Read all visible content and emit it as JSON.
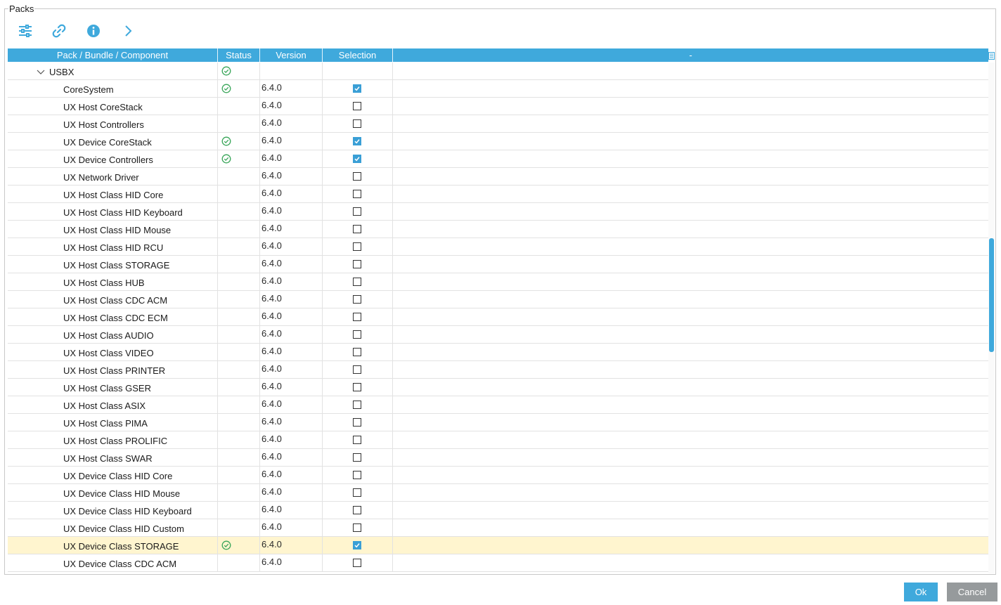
{
  "group_title": "Packs",
  "toolbar": {
    "icons": [
      "filter-settings-icon",
      "link-icon",
      "info-icon",
      "chevron-right-icon"
    ],
    "accent": "#3fa9dc"
  },
  "table": {
    "columns": {
      "name": "Pack / Bundle / Component",
      "status": "Status",
      "version": "Version",
      "selection": "Selection",
      "extra": "-"
    },
    "rows": [
      {
        "name": "USBX",
        "status": true,
        "version": "",
        "checked": null,
        "parent": true
      },
      {
        "name": "CoreSystem",
        "status": true,
        "version": "6.4.0",
        "checked": true
      },
      {
        "name": "UX Host CoreStack",
        "status": false,
        "version": "6.4.0",
        "checked": false
      },
      {
        "name": "UX Host Controllers",
        "status": false,
        "version": "6.4.0",
        "checked": false
      },
      {
        "name": "UX Device CoreStack",
        "status": true,
        "version": "6.4.0",
        "checked": true
      },
      {
        "name": "UX Device Controllers",
        "status": true,
        "version": "6.4.0",
        "checked": true
      },
      {
        "name": "UX Network Driver",
        "status": false,
        "version": "6.4.0",
        "checked": false
      },
      {
        "name": "UX Host Class HID Core",
        "status": false,
        "version": "6.4.0",
        "checked": false
      },
      {
        "name": "UX Host Class HID Keyboard",
        "status": false,
        "version": "6.4.0",
        "checked": false
      },
      {
        "name": "UX Host Class HID Mouse",
        "status": false,
        "version": "6.4.0",
        "checked": false
      },
      {
        "name": "UX Host Class HID RCU",
        "status": false,
        "version": "6.4.0",
        "checked": false
      },
      {
        "name": "UX Host Class STORAGE",
        "status": false,
        "version": "6.4.0",
        "checked": false
      },
      {
        "name": "UX Host Class HUB",
        "status": false,
        "version": "6.4.0",
        "checked": false
      },
      {
        "name": "UX Host Class CDC ACM",
        "status": false,
        "version": "6.4.0",
        "checked": false
      },
      {
        "name": "UX Host Class CDC ECM",
        "status": false,
        "version": "6.4.0",
        "checked": false
      },
      {
        "name": "UX Host Class AUDIO",
        "status": false,
        "version": "6.4.0",
        "checked": false
      },
      {
        "name": "UX Host Class VIDEO",
        "status": false,
        "version": "6.4.0",
        "checked": false
      },
      {
        "name": "UX Host Class PRINTER",
        "status": false,
        "version": "6.4.0",
        "checked": false
      },
      {
        "name": "UX Host Class GSER",
        "status": false,
        "version": "6.4.0",
        "checked": false
      },
      {
        "name": "UX Host Class ASIX",
        "status": false,
        "version": "6.4.0",
        "checked": false
      },
      {
        "name": "UX Host Class PIMA",
        "status": false,
        "version": "6.4.0",
        "checked": false
      },
      {
        "name": "UX Host Class PROLIFIC",
        "status": false,
        "version": "6.4.0",
        "checked": false
      },
      {
        "name": "UX Host Class SWAR",
        "status": false,
        "version": "6.4.0",
        "checked": false
      },
      {
        "name": "UX Device Class HID Core",
        "status": false,
        "version": "6.4.0",
        "checked": false
      },
      {
        "name": "UX Device Class HID Mouse",
        "status": false,
        "version": "6.4.0",
        "checked": false
      },
      {
        "name": "UX Device Class HID Keyboard",
        "status": false,
        "version": "6.4.0",
        "checked": false
      },
      {
        "name": "UX Device Class HID Custom",
        "status": false,
        "version": "6.4.0",
        "checked": false
      },
      {
        "name": "UX Device Class STORAGE",
        "status": true,
        "version": "6.4.0",
        "checked": true,
        "selected": true
      },
      {
        "name": "UX Device Class CDC ACM",
        "status": false,
        "version": "6.4.0",
        "checked": false
      }
    ]
  },
  "buttons": {
    "ok": "Ok",
    "cancel": "Cancel"
  },
  "colors": {
    "header": "#3fa9dc",
    "check": "#3a9fd6",
    "status_ok": "#3aa65a",
    "selected_row": "#fff5cf"
  }
}
